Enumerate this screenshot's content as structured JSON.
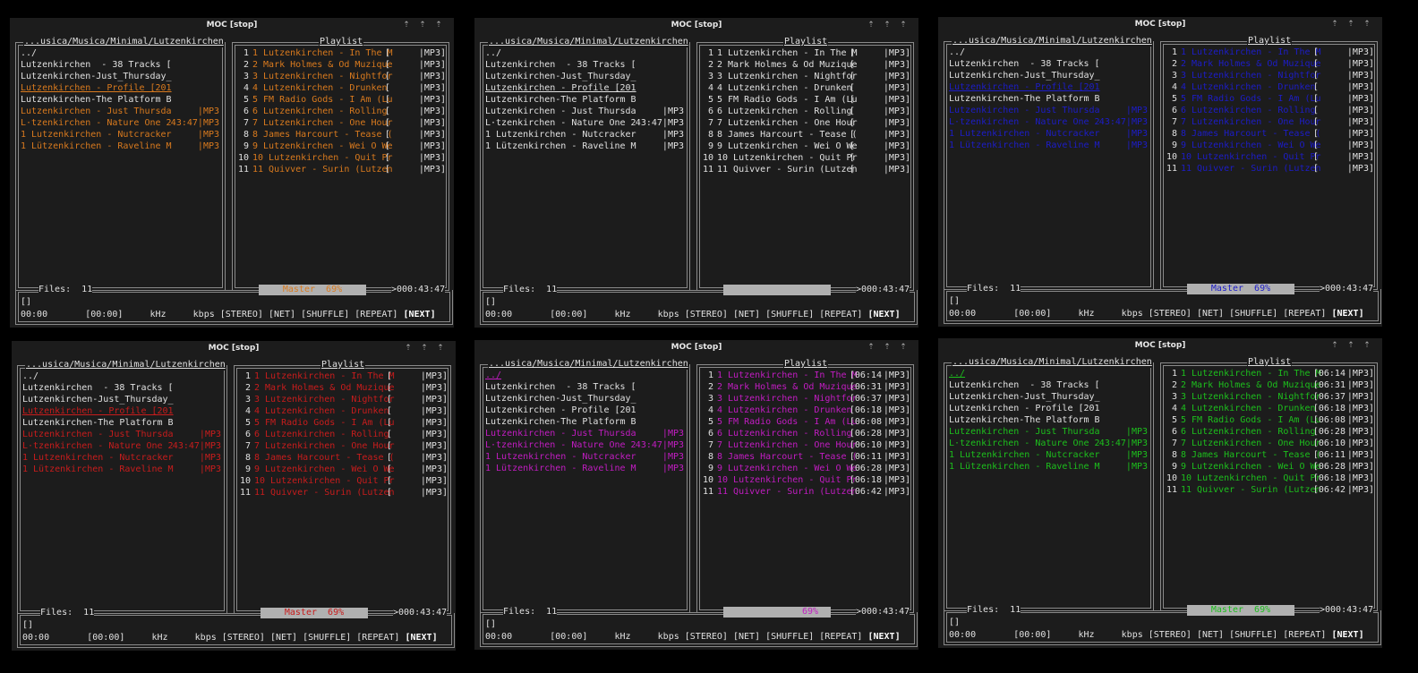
{
  "app_title": "MOC [stop]",
  "window_buttons": [
    "⇡",
    "⇡",
    "⇡"
  ],
  "directory": {
    "path": "...usica/Musica/Minimal/Lutzenkirchen",
    "items": [
      {
        "name": "../",
        "time": "",
        "format": ""
      },
      {
        "name": "Lutzenkirchen  - 38 Tracks [",
        "time": "",
        "format": ""
      },
      {
        "name": "Lutzenkirchen-Just_Thursday_",
        "time": "",
        "format": ""
      },
      {
        "name": "Lutzenkirchen - Profile [201",
        "time": "",
        "format": ""
      },
      {
        "name": "Lutzenkirchen-The Platform B",
        "time": "",
        "format": ""
      },
      {
        "name": "Lutzenkirchen - Just Thursda",
        "time": "",
        "format": "MP3"
      },
      {
        "name": "L·tzenkirchen - Nature One 2",
        "time": "43:47",
        "format": "MP3"
      },
      {
        "name": "1 Lutzenkirchen - Nutcracker",
        "time": "",
        "format": "MP3"
      },
      {
        "name": "1 Lützenkirchen - Raveline M",
        "time": "",
        "format": "MP3"
      }
    ],
    "files_label": "Files:",
    "files_count": "11"
  },
  "playlist": {
    "title": "Playlist",
    "items": [
      {
        "num": "1",
        "name": "1 Lutzenkirchen - In The M",
        "time": "06:14",
        "format": "MP3"
      },
      {
        "num": "2",
        "name": "2 Mark Holmes & Od Muzique",
        "time": "06:31",
        "format": "MP3"
      },
      {
        "num": "3",
        "name": "3 Lutzenkirchen - Nightfor",
        "time": "06:37",
        "format": "MP3"
      },
      {
        "num": "4",
        "name": "4 Lutzenkirchen - Drunken ",
        "time": "06:18",
        "format": "MP3"
      },
      {
        "num": "5",
        "name": "5 FM Radio Gods - I Am (Lu",
        "time": "06:08",
        "format": "MP3"
      },
      {
        "num": "6",
        "name": "6 Lutzenkirchen - Rolling ",
        "time": "06:28",
        "format": "MP3"
      },
      {
        "num": "7",
        "name": "7 Lutzenkirchen - One Hour",
        "time": "06:10",
        "format": "MP3"
      },
      {
        "num": "8",
        "name": "8 James Harcourt - Tease (",
        "time": "06:11",
        "format": "MP3"
      },
      {
        "num": "9",
        "name": "9 Lutzenkirchen - Wei O We",
        "time": "06:28",
        "format": "MP3"
      },
      {
        "num": "10",
        "name": "10 Lutzenkirchen - Quit Pr",
        "time": "06:18",
        "format": "MP3"
      },
      {
        "num": "11",
        "name": "11 Quivver - Surin (Lutzen",
        "time": "06:42",
        "format": "MP3"
      }
    ],
    "total_time": ">000:43:47"
  },
  "mixer": {
    "label": "Master",
    "value": "69%"
  },
  "status": {
    "title_line": "[]",
    "time_line": "00:00       [00:00]     kHz     kbps [STEREO] [NET] [SHUFFLE] [REPEAT] ",
    "next": "[NEXT]"
  },
  "windows": [
    {
      "theme": "orange",
      "color": "#d97a1e",
      "dir_hl_start": 5,
      "dir_ul": 3,
      "pl_hl": true,
      "pl_times": false,
      "master_text": "Master  69%"
    },
    {
      "theme": "mono",
      "color": "#e0e0e0",
      "dir_hl_start": 99,
      "dir_ul": 3,
      "pl_hl": false,
      "pl_times": false,
      "master_text": ""
    },
    {
      "theme": "blue",
      "color": "#1c1cc8",
      "dir_hl_start": 5,
      "dir_ul": 3,
      "pl_hl": true,
      "pl_times": false,
      "master_text": "Master  69%"
    },
    {
      "theme": "red",
      "color": "#c81c1c",
      "dir_hl_start": 5,
      "dir_ul": 3,
      "pl_hl": true,
      "pl_times": false,
      "master_text": "Master  69%"
    },
    {
      "theme": "magenta",
      "color": "#c21cc2",
      "dir_hl_start": 5,
      "dir_ul": 0,
      "pl_hl": true,
      "pl_times": true,
      "master_text": "69%"
    },
    {
      "theme": "green",
      "color": "#1cbf1c",
      "dir_hl_start": 5,
      "dir_ul": 0,
      "pl_hl": true,
      "pl_times": true,
      "master_text": "Master  69%"
    }
  ]
}
